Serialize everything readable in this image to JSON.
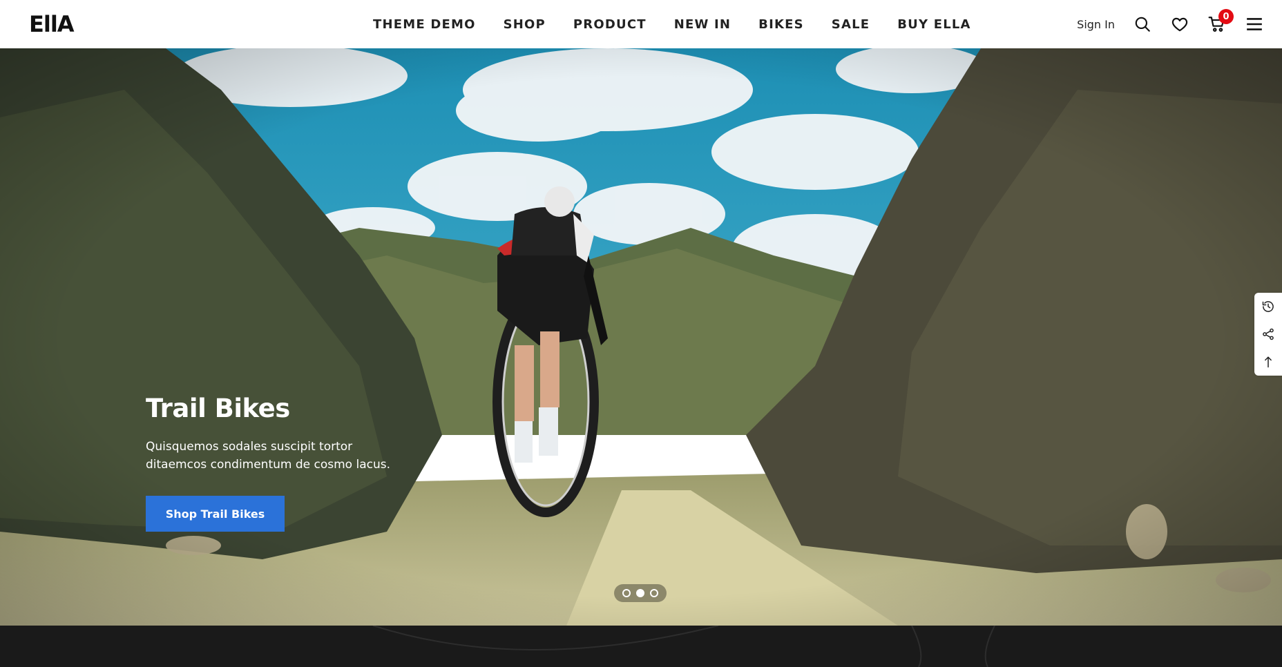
{
  "brand": {
    "logo_text": "EllA"
  },
  "nav": {
    "items": [
      {
        "label": "THEME DEMO"
      },
      {
        "label": "SHOP"
      },
      {
        "label": "PRODUCT"
      },
      {
        "label": "NEW IN"
      },
      {
        "label": "BIKES"
      },
      {
        "label": "SALE"
      },
      {
        "label": "BUY ELLA"
      }
    ]
  },
  "header_right": {
    "signin_label": "Sign In",
    "cart_count": "0",
    "icons": [
      "search-icon",
      "heart-icon",
      "cart-icon",
      "menu-icon"
    ]
  },
  "hero": {
    "title": "Trail Bikes",
    "description": "Quisquemos sodales suscipit tortor ditaemcos condimentum de cosmo lacus.",
    "cta_label": "Shop Trail Bikes",
    "slides": 3,
    "active_slide": 2
  },
  "side_tools": [
    "history-icon",
    "share-icon",
    "scroll-top-icon"
  ],
  "colors": {
    "accent": "#2b72d9",
    "badge": "#e30b13",
    "footer": "#1a1a1a"
  }
}
